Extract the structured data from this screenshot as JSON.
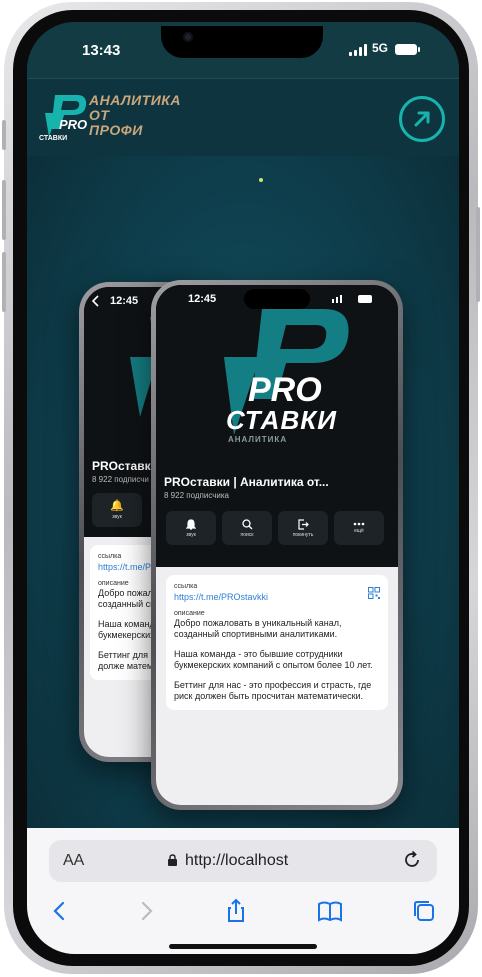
{
  "status": {
    "time": "13:43",
    "network": "5G"
  },
  "header": {
    "logo_pro": "PRO",
    "logo_sub": "СТАВКИ",
    "brand_line1": "АНАЛИТИКА",
    "brand_line2": "ОТ",
    "brand_line3": "ПРОФИ"
  },
  "mockup_front": {
    "time": "12:45",
    "big_logo_pro": "PRO",
    "big_logo_stavki": "СТАВКИ",
    "big_logo_analytics": "АНАЛИТИКА",
    "channel_title": "PROставки | Аналитика от...",
    "subscribers": "8 922 подписчика",
    "actions": [
      {
        "label": "звук",
        "icon": "bell-icon"
      },
      {
        "label": "поиск",
        "icon": "search-icon"
      },
      {
        "label": "покинуть",
        "icon": "leave-icon"
      },
      {
        "label": "ещё",
        "icon": "more-icon"
      }
    ],
    "link_label": "ссылка",
    "link_url": "https://t.me/PROstavkki",
    "desc_label": "описание",
    "desc_p1": "Добро пожаловать в уникальный канал, созданный спортивными аналитиками.",
    "desc_p2": "Наша команда - это бывшие сотрудники букмекерских компаний с опытом более 10 лет.",
    "desc_p3": "Беттинг для нас - это профессия и страсть, где риск должен быть просчитан математически."
  },
  "mockup_back": {
    "time": "12:45",
    "channel_title": "PROставки",
    "subscribers": "8 922 подписчи",
    "action_label": "звук",
    "link_label": "ссылка",
    "link_url": "https://t.me/P",
    "desc_label": "описание",
    "desc_p1": "Добро пожалов созданный сп",
    "desc_p2": "Наша команд букмекерских лет.",
    "desc_p3": "Беттинг для н где риск долже математичес"
  },
  "safari": {
    "aa_label": "AA",
    "url": "http://localhost"
  },
  "colors": {
    "accent": "#17b3ad",
    "brand_gold": "#c9a77b",
    "link": "#2f7fd6"
  }
}
